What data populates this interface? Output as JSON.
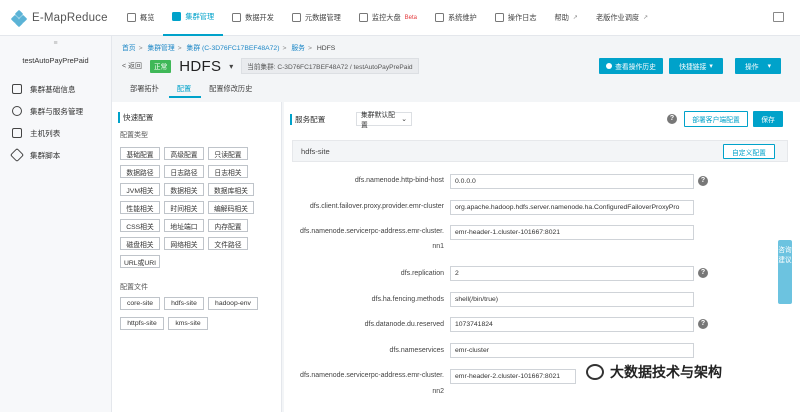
{
  "brand": {
    "name": "E-MapReduce"
  },
  "nav": [
    {
      "label": "概览"
    },
    {
      "label": "集群管理"
    },
    {
      "label": "数据开发"
    },
    {
      "label": "元数据管理"
    },
    {
      "label": "监控大盘",
      "badge": "Beta"
    },
    {
      "label": "系统维护"
    },
    {
      "label": "操作日志"
    },
    {
      "label": "帮助"
    },
    {
      "label": "老版作业调度"
    }
  ],
  "sidebar": {
    "cluster_name": "testAutoPayPrePaid",
    "items": [
      {
        "label": "集群基础信息"
      },
      {
        "label": "集群与服务管理"
      },
      {
        "label": "主机列表"
      },
      {
        "label": "集群脚本"
      }
    ]
  },
  "breadcrumb": {
    "items": [
      "首页",
      "集群管理",
      "集群 (C-3D76FC17BEF48A72)",
      "服务"
    ],
    "current": "HDFS"
  },
  "header": {
    "back_label": "< 返回",
    "status": "正常",
    "title": "HDFS",
    "cluster_tag": "当前集群: C-3D76FC17BEF48A72 / testAutoPayPrePaid",
    "history_button": "查看操作历史",
    "quick_link_button": "快捷链接",
    "action_button": "操作"
  },
  "tabs": [
    {
      "label": "部署拓扑"
    },
    {
      "label": "配置"
    },
    {
      "label": "配置修改历史"
    }
  ],
  "quick_config": {
    "title": "快速配置",
    "type_label": "配置类型",
    "types": [
      "基础配置",
      "高级配置",
      "只读配置",
      "数据路径",
      "日志路径",
      "日志相关",
      "JVM相关",
      "数据相关",
      "数据库相关",
      "性能相关",
      "时间相关",
      "编解码相关",
      "CSS相关",
      "地址端口",
      "内存配置",
      "磁盘相关",
      "网络相关",
      "文件路径",
      "URL或URI"
    ],
    "file_label": "配置文件",
    "files": [
      "core-site",
      "hdfs-site",
      "hadoop-env",
      "httpfs-site",
      "kms-site"
    ]
  },
  "service_config": {
    "label": "服务配置",
    "scope_select": "集群默认配置",
    "deploy_button": "部署客户端配置",
    "save_button": "保存",
    "section": "hdfs-site",
    "custom_button": "自定义配置",
    "rows": [
      {
        "key": "dfs.namenode.http-bind-host",
        "value": "0.0.0.0",
        "help": true
      },
      {
        "key": "dfs.client.failover.proxy.provider.emr-cluster",
        "value": "org.apache.hadoop.hdfs.server.namenode.ha.ConfiguredFailoverProxyPro",
        "help": false
      },
      {
        "key": "dfs.namenode.servicerpc-address.emr-cluster.",
        "key2": "nn1",
        "value": "emr-header-1.cluster-101667:8021",
        "help": false
      },
      {
        "key": "dfs.replication",
        "value": "2",
        "help": true
      },
      {
        "key": "dfs.ha.fencing.methods",
        "value": "shell(/bin/true)",
        "help": false
      },
      {
        "key": "dfs.datanode.du.reserved",
        "value": "1073741824",
        "help": true
      },
      {
        "key": "dfs.nameservices",
        "value": "emr-cluster",
        "help": false
      },
      {
        "key": "dfs.namenode.servicerpc-address.emr-cluster.",
        "key2": "nn2",
        "value": "emr-header-2.cluster-101667:8021",
        "help": false
      }
    ]
  },
  "float_tab": {
    "label": "咨询建议"
  },
  "watermark": {
    "text": "大数据技术与架构"
  },
  "colors": {
    "accent": "#00a2ca",
    "status_ok": "#3fb858"
  }
}
